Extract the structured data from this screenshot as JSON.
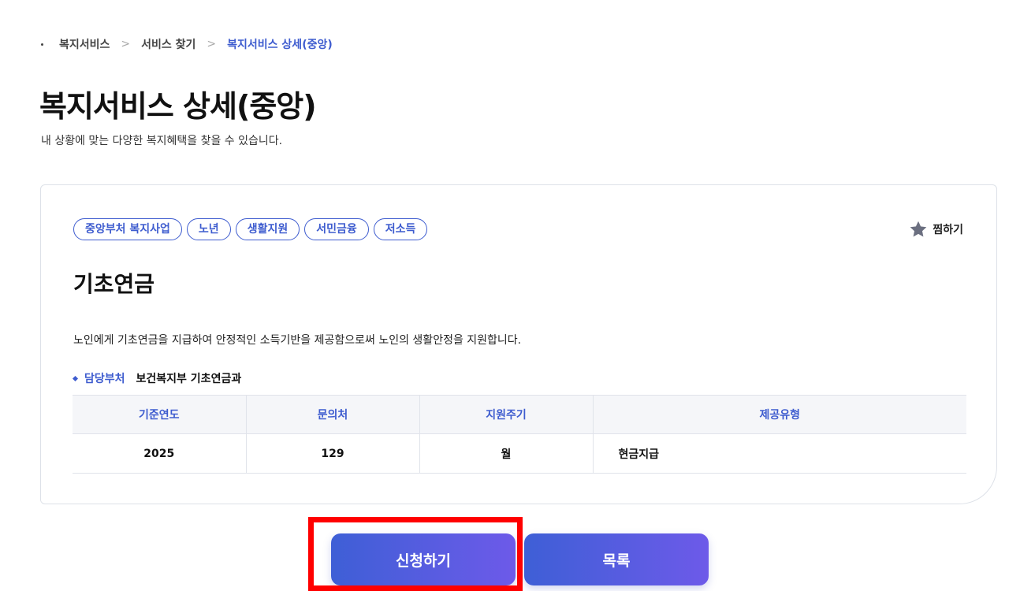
{
  "breadcrumb": {
    "items": [
      "복지서비스",
      "서비스 찾기",
      "복지서비스 상세(중앙)"
    ]
  },
  "page": {
    "title": "복지서비스 상세(중앙)",
    "subtitle": "내 상황에 맞는 다양한 복지혜택을 찾을 수 있습니다."
  },
  "service": {
    "tags": [
      "중앙부처 복지사업",
      "노년",
      "생활지원",
      "서민금융",
      "저소득"
    ],
    "bookmark_label": "찜하기",
    "title": "기초연금",
    "description": "노인에게 기초연금을 지급하여 안정적인 소득기반을 제공함으로써 노인의 생활안정을 지원합니다.",
    "dept_label": "담당부처",
    "dept_value": "보건복지부 기초연금과"
  },
  "table": {
    "headers": [
      "기준연도",
      "문의처",
      "지원주기",
      "제공유형"
    ],
    "row": [
      "2025",
      "129",
      "월",
      "현금지급"
    ]
  },
  "buttons": {
    "apply_label": "신청하기",
    "list_label": "목록"
  },
  "colors": {
    "accent": "#3e5ccf",
    "button_gradient_start": "#3e5fd6",
    "button_gradient_end": "#6d5ae9",
    "highlight": "#ff0000"
  },
  "icons": {
    "bookmark": "star-icon",
    "breadcrumb_separator": "chevron-right-icon"
  }
}
